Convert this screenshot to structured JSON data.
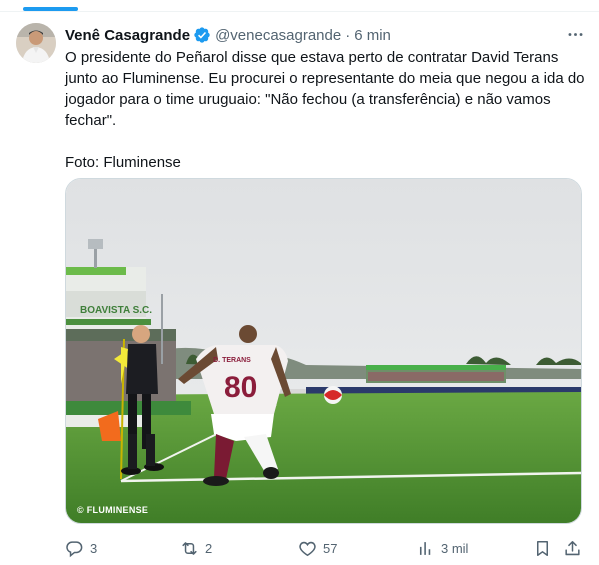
{
  "tweet": {
    "author_name": "Venê Casagrande",
    "handle": "@venecasagrande",
    "separator": "·",
    "time": "6 min",
    "text": "O presidente do Peñarol disse que estava perto de contratar David Terans junto ao Fluminense. Eu procurei o representante do meia que negou a ida do jogador para o time uruguaio: \"Não fechou (a transferência) e não vamos fechar\".",
    "photo_credit": "Foto: Fluminense",
    "media": {
      "watermark": "© FLUMINENSE",
      "player_number": "80",
      "player_name": "D. TERANS",
      "stadium_sign": "BOAVISTA S.C."
    }
  },
  "actions": {
    "replies": "3",
    "retweets": "2",
    "likes": "57",
    "views": "3 mil"
  },
  "colors": {
    "accent": "#1d9bf0",
    "text": "#0f1419",
    "secondary": "#536471",
    "pitch": "#5a9a3a",
    "sky": "#e6e8ea"
  },
  "icons": [
    "verified-badge-icon",
    "more-options-icon",
    "reply-icon",
    "retweet-icon",
    "like-icon",
    "views-icon",
    "bookmark-icon",
    "share-icon"
  ]
}
